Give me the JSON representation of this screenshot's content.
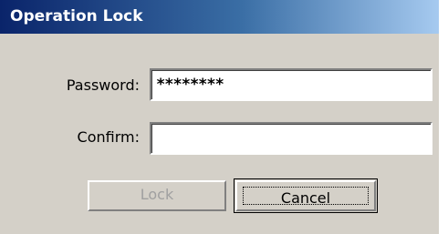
{
  "window": {
    "title": "Operation Lock"
  },
  "form": {
    "password_label": "Password:",
    "password_value": "********",
    "confirm_label": "Confirm:",
    "confirm_value": ""
  },
  "buttons": {
    "lock_label": "Lock",
    "lock_enabled": false,
    "cancel_label": "Cancel",
    "cancel_focused": true
  },
  "colors": {
    "title_start": "#0a246a",
    "title_end": "#a6caf0",
    "dialog_bg": "#d4d0c8",
    "disabled_text": "#a0a0a0"
  }
}
